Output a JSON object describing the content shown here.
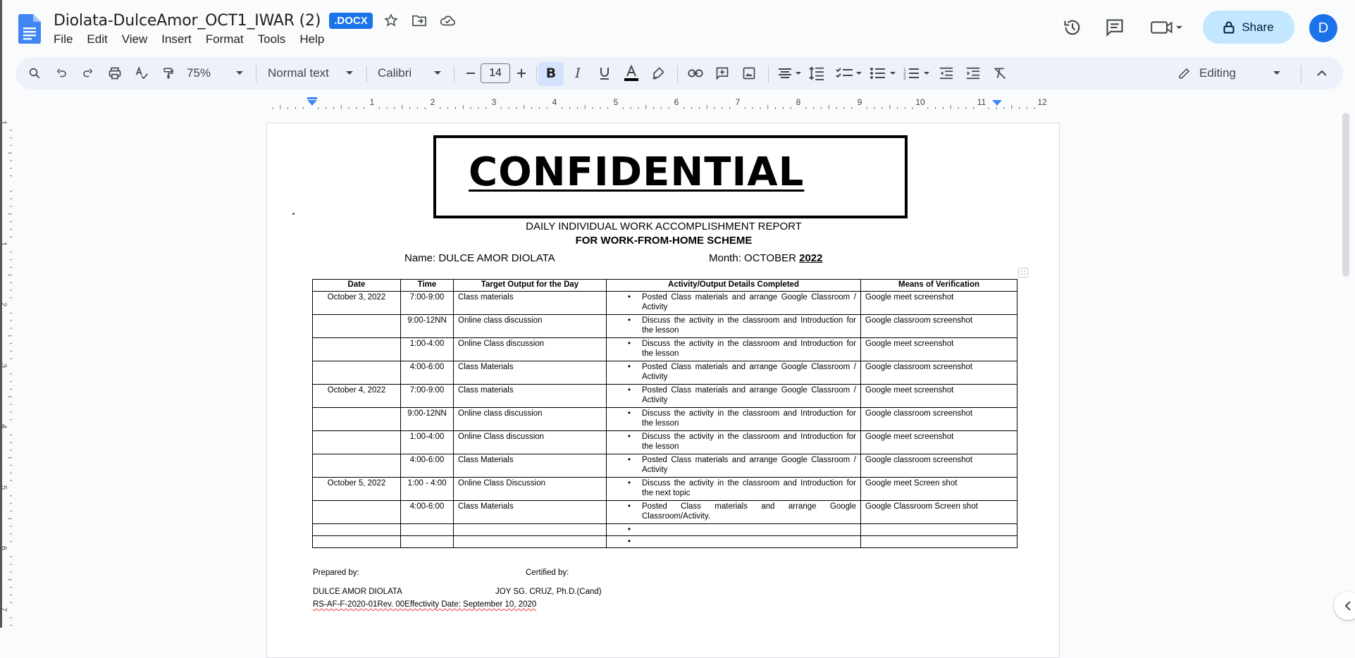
{
  "app": {
    "doc_title": "Diolata-DulceAmor_OCT1_IWAR (2)",
    "format_badge": ".DOCX",
    "menu": [
      "File",
      "Edit",
      "View",
      "Insert",
      "Format",
      "Tools",
      "Help"
    ],
    "share_label": "Share",
    "avatar_letter": "D",
    "accent": "#1a73e8",
    "share_bg": "#c2e7ff"
  },
  "toolbar": {
    "zoom": "75%",
    "style": "Normal text",
    "font": "Calibri",
    "font_size": "14",
    "mode": "Editing"
  },
  "ruler": {
    "h_marks": [
      "1",
      "2",
      "3",
      "4",
      "5",
      "6",
      "7",
      "8",
      "9",
      "10",
      "11",
      "12"
    ],
    "v_marks": [
      "1",
      "1",
      "2",
      "3",
      "4",
      "5",
      "6",
      "7"
    ]
  },
  "document": {
    "confidential": "CONFIDENTIAL",
    "heading1": "DAILY INDIVIDUAL WORK ACCOMPLISHMENT REPORT",
    "heading2": "FOR WORK-FROM-HOME SCHEME",
    "name_label": "Name: DULCE AMOR DIOLATA",
    "month_label": "Month: OCTOBER",
    "month_year": "2022",
    "table": {
      "headers": [
        "Date",
        "Time",
        "Target Output for the Day",
        "Activity/Output Details Completed",
        "Means of Verification"
      ],
      "rows": [
        {
          "date": "October 3, 2022",
          "time": "7:00-9:00",
          "target": "Class materials",
          "activity": "Posted Class materials and arrange Google Classroom / Activity",
          "means": "Google meet screenshot"
        },
        {
          "date": "",
          "time": "9:00-12NN",
          "target": "Online class discussion",
          "activity": "Discuss the activity in the classroom and Introduction for the lesson",
          "means": "Google classroom screenshot"
        },
        {
          "date": "",
          "time": "1:00-4:00",
          "target": "Online Class discussion",
          "activity": "Discuss the activity in the classroom and Introduction for the lesson",
          "means": "Google meet screenshot"
        },
        {
          "date": "",
          "time": "4:00-6:00",
          "target": "Class Materials",
          "activity": "Posted Class materials and arrange Google Classroom / Activity",
          "means": "Google classroom screenshot"
        },
        {
          "date": "October 4, 2022",
          "time": "7:00-9:00",
          "target": "Class materials",
          "activity": "Posted Class materials and arrange Google Classroom / Activity",
          "means": "Google meet screenshot"
        },
        {
          "date": "",
          "time": "9:00-12NN",
          "target": "Online class discussion",
          "activity": "Discuss the activity in the classroom and Introduction for the lesson",
          "means": "Google classroom screenshot"
        },
        {
          "date": "",
          "time": "1:00-4:00",
          "target": "Online Class discussion",
          "activity": "Discuss the activity in the classroom and Introduction for the lesson",
          "means": "Google meet screenshot"
        },
        {
          "date": "",
          "time": "4:00-6:00",
          "target": "Class Materials",
          "activity": "Posted Class materials and arrange Google Classroom / Activity",
          "means": "Google classroom screenshot"
        },
        {
          "date": "October 5, 2022",
          "time": "1:00 - 4:00",
          "target": "Online Class Discussion",
          "activity": "Discuss the activity in the classroom and Introduction for the next topic",
          "means": "Google meet Screen shot"
        },
        {
          "date": "",
          "time": "4:00-6:00",
          "target": "Class Materials",
          "activity": "Posted Class materials and arrange Google Classroom/Activity.",
          "means": "Google Classroom Screen shot"
        }
      ],
      "bullet": "•"
    },
    "prepared_by": "Prepared by:",
    "certified_by": "Certified by:",
    "preparer": "DULCE AMOR DIOLATA",
    "certifier": "JOY SG. CRUZ, Ph.D.(Cand)",
    "form_code": "RS-AF-F-2020-01Rev. 00Effectivity Date: September 10, 2020"
  }
}
